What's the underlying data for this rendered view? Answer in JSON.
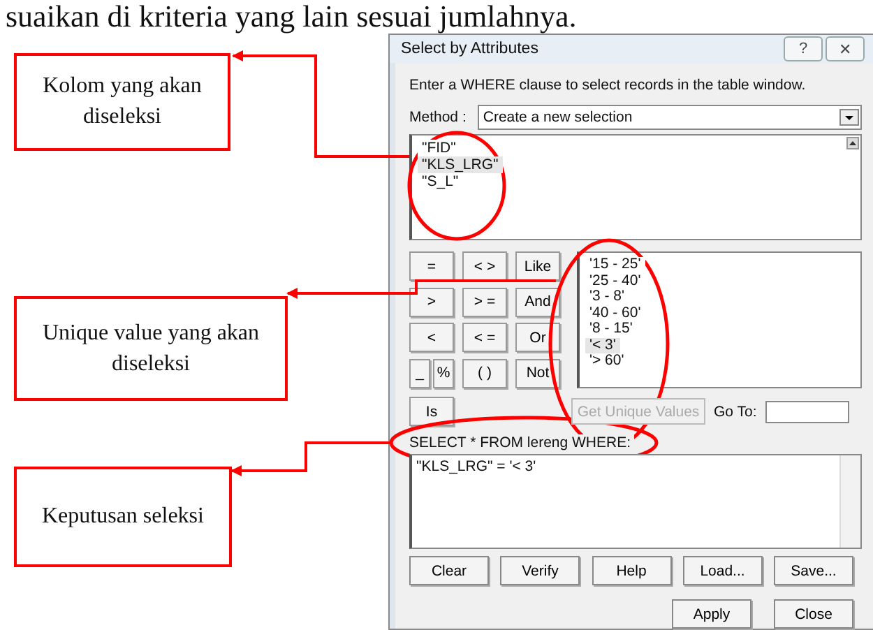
{
  "heading": "suaikan di kriteria yang lain sesuai jumlahnya.",
  "callouts": [
    "Kolom yang akan diseleksi",
    "Unique value yang akan diseleksi",
    "Keputusan seleksi"
  ],
  "window": {
    "title": "Select by Attributes",
    "help_glyph": "?",
    "close_glyph": "✕"
  },
  "instruction": "Enter a WHERE clause to select records in the table window.",
  "method": {
    "label": "Method :",
    "value": "Create a new selection"
  },
  "fields": [
    {
      "label": "\"FID\"",
      "selected": false
    },
    {
      "label": "\"KLS_LRG\"",
      "selected": true
    },
    {
      "label": "\"S_L\"",
      "selected": false
    }
  ],
  "operators": [
    "=",
    "< >",
    "Like",
    ">",
    "> =",
    "And",
    "<",
    "< =",
    "Or",
    "_",
    "%",
    "( )",
    "Not",
    "Is"
  ],
  "values": [
    {
      "label": "'15 - 25'",
      "selected": false
    },
    {
      "label": "'25 - 40'",
      "selected": false
    },
    {
      "label": "'3 - 8'",
      "selected": false
    },
    {
      "label": "'40 - 60'",
      "selected": false
    },
    {
      "label": "'8 - 15'",
      "selected": false
    },
    {
      "label": "'< 3'",
      "selected": true
    },
    {
      "label": "'> 60'",
      "selected": false
    }
  ],
  "unique_button": {
    "label": "Get Unique Values",
    "disabled": true
  },
  "goto": {
    "label": "Go To:"
  },
  "query_label": "SELECT * FROM lereng WHERE:",
  "query": "\"KLS_LRG\" = '< 3'",
  "actions": [
    "Clear",
    "Verify",
    "Help",
    "Load...",
    "Save..."
  ],
  "footer_buttons": [
    "Apply",
    "Close"
  ]
}
